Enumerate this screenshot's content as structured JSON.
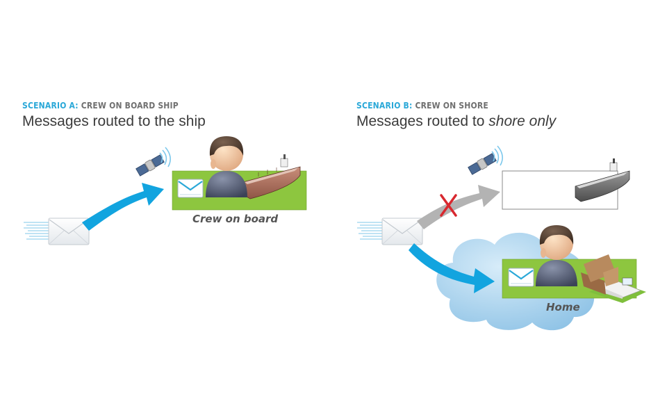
{
  "colors": {
    "accent": "#2aa8d8",
    "muted": "#707070",
    "arrow_blue": "#12a4df",
    "arrow_grey": "#b3b3b3",
    "cross_red": "#d8282f",
    "panel_green": "#8dc63f",
    "cloud_blue": "#a9d3ee"
  },
  "scenario_a": {
    "label_key": "SCENARIO A:",
    "label_rest": "CREW ON BOARD SHIP",
    "title": "Messages routed to the ship",
    "caption": "Crew on board",
    "icons": [
      "envelope-icon",
      "satellite-icon",
      "person-icon",
      "ship-icon"
    ]
  },
  "scenario_b": {
    "label_key": "SCENARIO B:",
    "label_rest": "CREW ON SHORE",
    "title_plain": "Messages routed to ",
    "title_em": "shore only",
    "caption": "Home",
    "icons": [
      "envelope-icon",
      "satellite-icon",
      "blocked-x-icon",
      "ship-icon",
      "cloud-icon",
      "person-icon",
      "house-icon"
    ]
  }
}
